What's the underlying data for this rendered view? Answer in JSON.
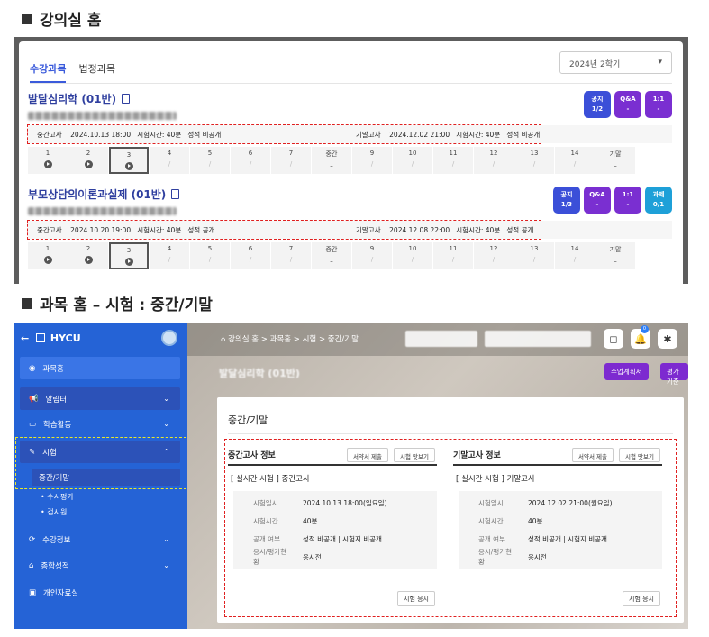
{
  "section1_title": "강의실 홈",
  "section2_title": "과목 홈 – 시험 : 중간/기말",
  "lecture_home": {
    "tabs": [
      "수강과목",
      "법정과목"
    ],
    "semester_select": "2024년 2학기",
    "courses": [
      {
        "title": "발달심리학 (01반)",
        "badges": [
          {
            "label": "공지",
            "value": "1/2",
            "color": "#3b4fd8"
          },
          {
            "label": "Q&A",
            "value": "-",
            "color": "#7a2fd1"
          },
          {
            "label": "1:1",
            "value": "-",
            "color": "#7a2fd1"
          }
        ],
        "midterm": {
          "label": "중간고사",
          "datetime": "2024.10.13 18:00",
          "duration": "시험시간: 40분",
          "score": "성적 비공개"
        },
        "final": {
          "label": "기말고사",
          "datetime": "2024.12.02 21:00",
          "duration": "시험시간: 40분",
          "score": "성적 비공개"
        },
        "weeks": [
          {
            "no": "1",
            "mark": "play"
          },
          {
            "no": "2",
            "mark": "play"
          },
          {
            "no": "3",
            "mark": "play",
            "current": true
          },
          {
            "no": "4",
            "mark": "/"
          },
          {
            "no": "5",
            "mark": "/"
          },
          {
            "no": "6",
            "mark": "/"
          },
          {
            "no": "7",
            "mark": "/"
          },
          {
            "no": "중간",
            "mark": "–"
          },
          {
            "no": "9",
            "mark": "/"
          },
          {
            "no": "10",
            "mark": "/"
          },
          {
            "no": "11",
            "mark": "/"
          },
          {
            "no": "12",
            "mark": "/"
          },
          {
            "no": "13",
            "mark": "/"
          },
          {
            "no": "14",
            "mark": "/"
          },
          {
            "no": "기말",
            "mark": "–"
          }
        ]
      },
      {
        "title": "부모상담의이론과실제 (01반)",
        "badges": [
          {
            "label": "공지",
            "value": "1/3",
            "color": "#3b4fd8"
          },
          {
            "label": "Q&A",
            "value": "-",
            "color": "#7a2fd1"
          },
          {
            "label": "1:1",
            "value": "-",
            "color": "#7a2fd1"
          },
          {
            "label": "과제",
            "value": "0/1",
            "color": "#1ea0d8"
          }
        ],
        "midterm": {
          "label": "중간고사",
          "datetime": "2024.10.20 19:00",
          "duration": "시험시간: 40분",
          "score": "성적 공개"
        },
        "final": {
          "label": "기말고사",
          "datetime": "2024.12.08 22:00",
          "duration": "시험시간: 40분",
          "score": "성적 공개"
        },
        "weeks": [
          {
            "no": "1",
            "mark": "play"
          },
          {
            "no": "2",
            "mark": "play"
          },
          {
            "no": "3",
            "mark": "play",
            "current": true
          },
          {
            "no": "4",
            "mark": "/"
          },
          {
            "no": "5",
            "mark": "/"
          },
          {
            "no": "6",
            "mark": "/"
          },
          {
            "no": "7",
            "mark": "/"
          },
          {
            "no": "중간",
            "mark": "–"
          },
          {
            "no": "9",
            "mark": "/"
          },
          {
            "no": "10",
            "mark": "/"
          },
          {
            "no": "11",
            "mark": "/"
          },
          {
            "no": "12",
            "mark": "/"
          },
          {
            "no": "13",
            "mark": "/"
          },
          {
            "no": "14",
            "mark": "/"
          },
          {
            "no": "기말",
            "mark": "–"
          }
        ]
      }
    ]
  },
  "course_home": {
    "brand": "HYCU",
    "sidebar": [
      {
        "label": "과목홈",
        "icon": "circle-dot-icon"
      },
      {
        "label": "알림터",
        "icon": "megaphone-icon"
      },
      {
        "label": "학습활동",
        "icon": "monitor-icon"
      },
      {
        "label": "시험",
        "icon": "pencil-doc-icon"
      },
      {
        "label": "수강정보",
        "icon": "refresh-icon"
      },
      {
        "label": "종합성적",
        "icon": "bank-icon"
      },
      {
        "label": "개인자료실",
        "icon": "save-icon"
      }
    ],
    "exam_sub": [
      "중간/기말",
      "수시평가",
      "검시원"
    ],
    "breadcrumb": "강의실 홈 > 과목홈 > 시험 > 중간/기말",
    "buttons": {
      "plan": "수업계획서",
      "criteria": "평가기준"
    },
    "card_title": "중간/기말",
    "midterm_info": {
      "header": "중간고사 정보",
      "pledge_btn": "서약서 제출",
      "practice_btn": "시험 맛보기",
      "subtitle": "[ 실시간 시험 ] 중간고사",
      "rows": [
        {
          "k": "시험일시",
          "v": "2024.10.13 18:00(일요일)"
        },
        {
          "k": "시험시간",
          "v": "40분"
        },
        {
          "k": "공개 여부",
          "v": "성적 비공개 | 시험지 비공개"
        },
        {
          "k": "응시/평가현황",
          "v": "응시전"
        }
      ],
      "go_btn": "시험 응시"
    },
    "final_info": {
      "header": "기말고사 정보",
      "pledge_btn": "서약서 제출",
      "practice_btn": "시험 맛보기",
      "subtitle": "[ 실시간 시험 ] 기말고사",
      "rows": [
        {
          "k": "시험일시",
          "v": "2024.12.02 21:00(월요일)"
        },
        {
          "k": "시험시간",
          "v": "40분"
        },
        {
          "k": "공개 여부",
          "v": "성적 비공개 | 시험지 비공개"
        },
        {
          "k": "응시/평가현황",
          "v": "응시전"
        }
      ],
      "go_btn": "시험 응시"
    },
    "notification_count": "0"
  }
}
